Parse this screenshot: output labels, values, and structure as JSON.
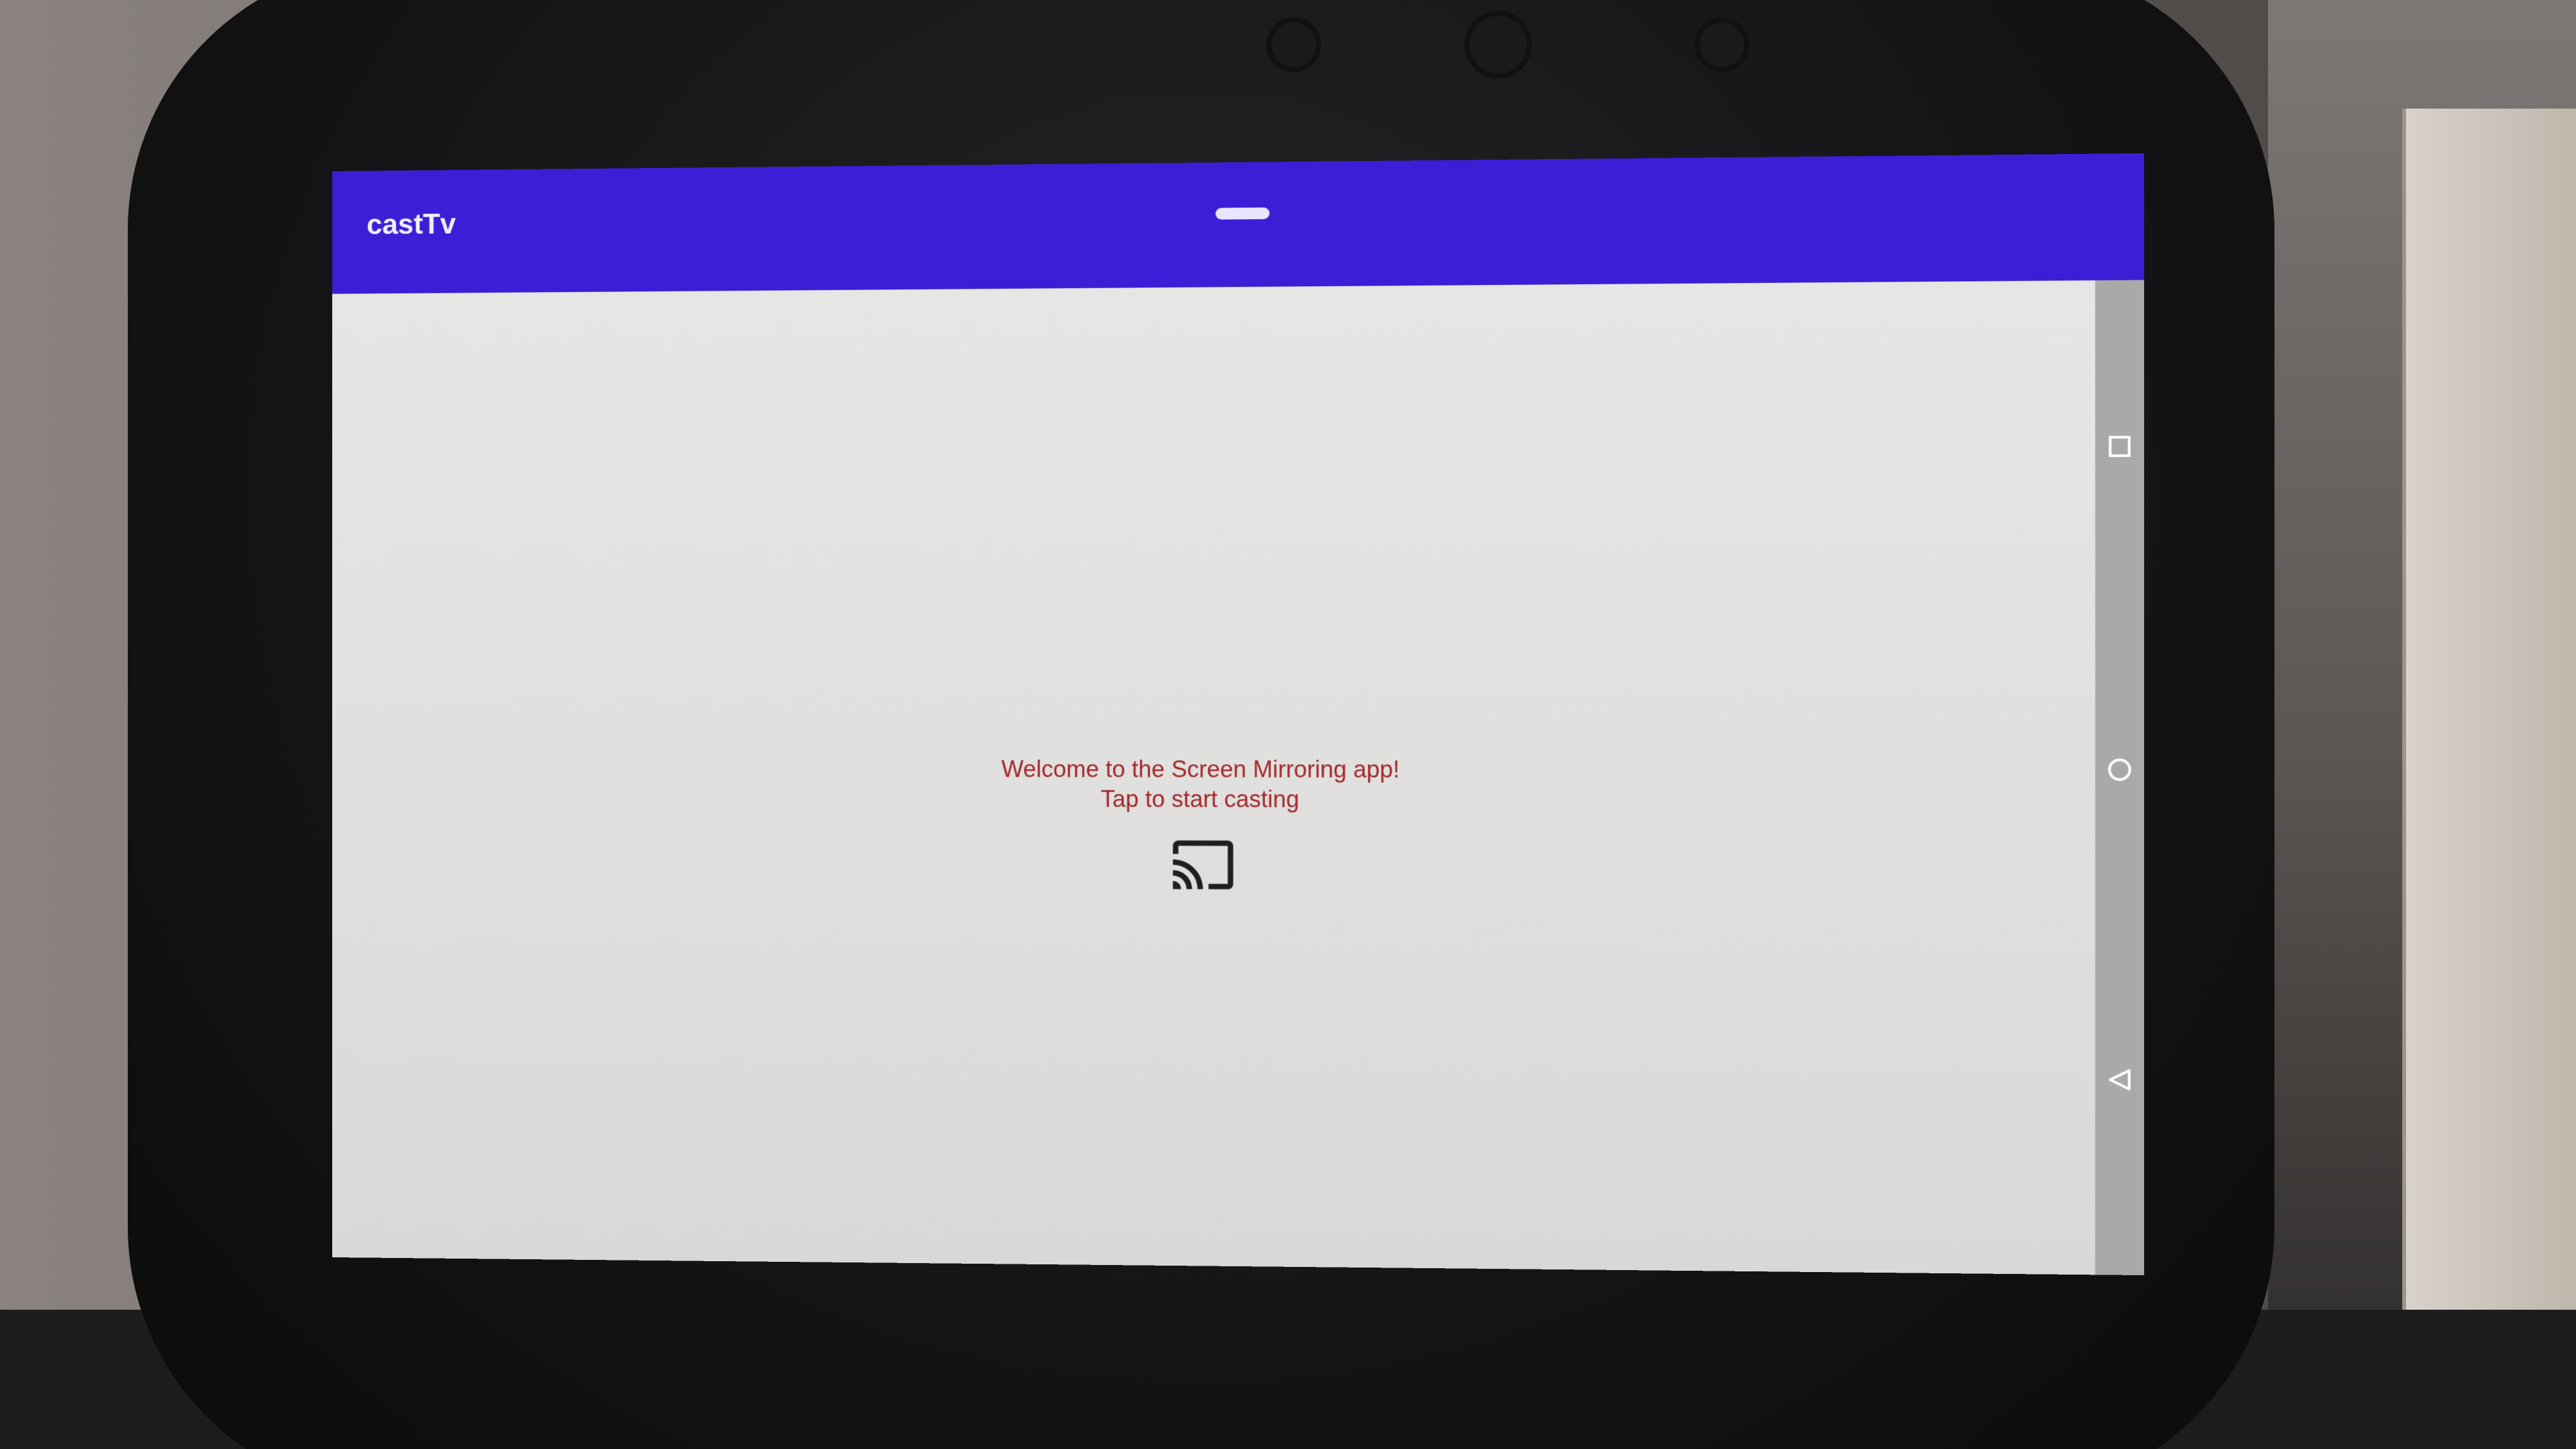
{
  "app": {
    "title": "castTv"
  },
  "main": {
    "welcome_line1": "Welcome to the Screen Mirroring app!",
    "welcome_line2": "Tap to start casting",
    "cast_icon": "cast-icon"
  },
  "navigation": {
    "buttons": [
      "recents-icon",
      "home-icon",
      "back-icon"
    ]
  },
  "colors": {
    "app_bar": "#3a1fd6",
    "welcome_text": "#a4282b",
    "screen_background": "#e4e4e2",
    "nav_bar": "#a9a9a7"
  }
}
